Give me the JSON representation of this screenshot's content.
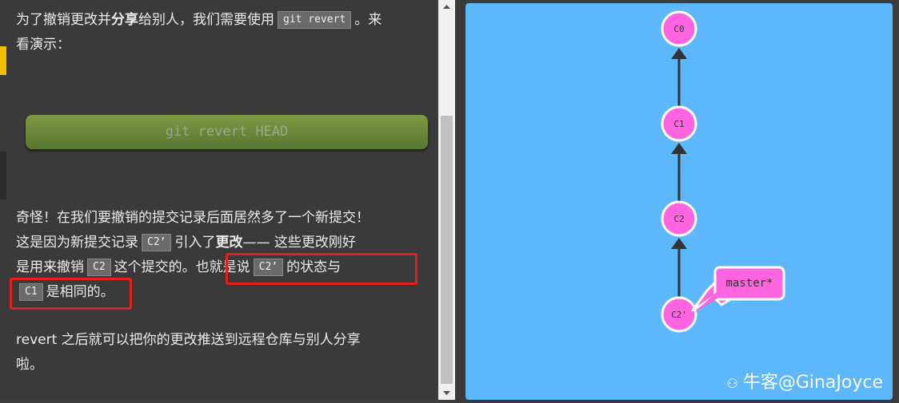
{
  "text": {
    "p1_a": "为了撤销更改并",
    "p1_bold": "分享",
    "p1_b": "给别人，我们需要使用",
    "p1_code": "git revert",
    "p1_c": "。来",
    "p1_line2": "看演示：",
    "command": "git revert HEAD",
    "p2_line1": "奇怪！在我们要撤销的提交记录后面居然多了一个新提交！",
    "p2_l2a": "这是因为新提交记录",
    "p2_l2code": "C2’",
    "p2_l2b": "引入了",
    "p2_l2bold": "更改",
    "p2_l2c": "—— 这些更改刚好",
    "p2_l3a": "是用来撤销",
    "p2_l3code": "C2",
    "p2_l3b": "这个提交的。",
    "p2_l3c": "也就是说",
    "p2_l3code2": "C2’",
    "p2_l3d": "的状态与",
    "p2_l4code": "C1",
    "p2_l4b": "是相同的。",
    "p3_line1": "revert 之后就可以把你的更改推送到远程仓库与别人分享",
    "p3_line2": "啦。"
  },
  "graph": {
    "commits": [
      "C0",
      "C1",
      "C2",
      "C2'"
    ],
    "branch": "master*"
  },
  "watermark": "牛客@GinaJoyce",
  "colors": {
    "viz_bg": "#5cb8fb",
    "commit_fill": "#ff64e0",
    "highlight": "#e5201c",
    "button": "#6d8a3c"
  }
}
